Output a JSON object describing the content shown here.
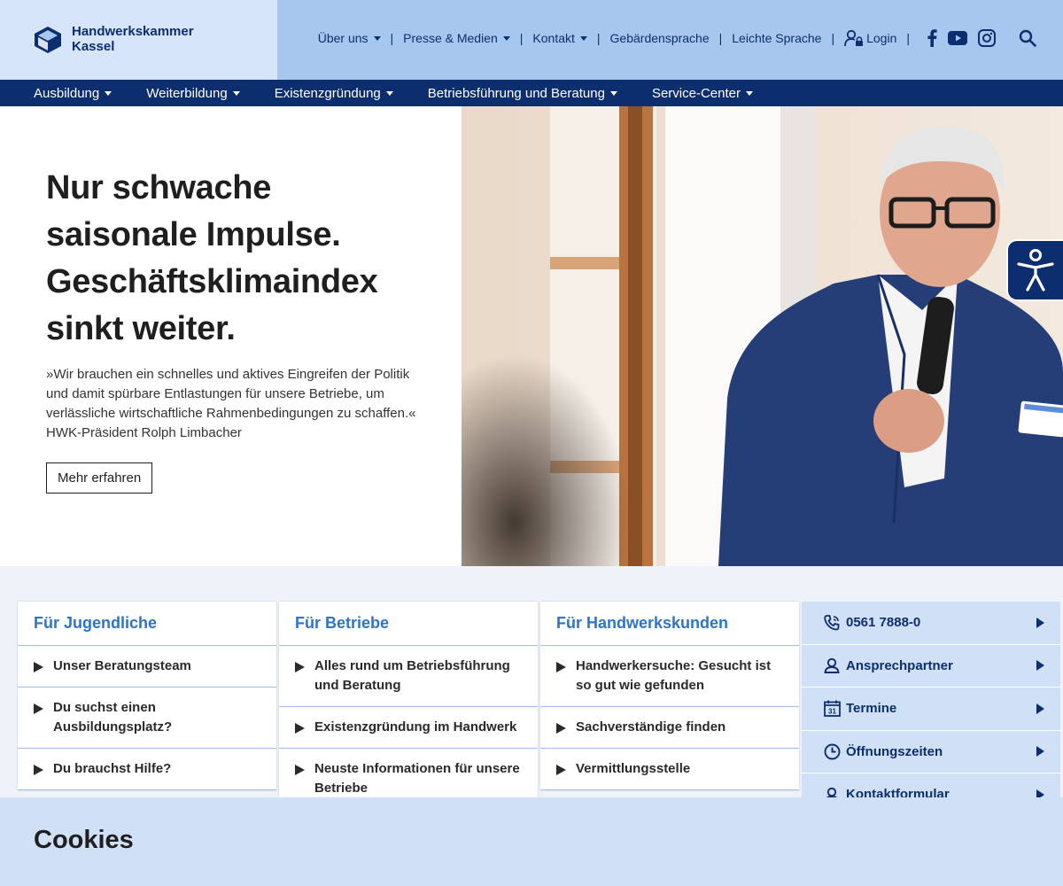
{
  "header": {
    "logo_line1": "Handwerkskammer",
    "logo_line2": "Kassel",
    "meta_nav": [
      {
        "label": "Über uns",
        "dropdown": true
      },
      {
        "label": "Presse & Medien",
        "dropdown": true
      },
      {
        "label": "Kontakt",
        "dropdown": true
      },
      {
        "label": "Gebärdensprache",
        "dropdown": false
      },
      {
        "label": "Leichte Sprache",
        "dropdown": false
      }
    ],
    "login_label": "Login",
    "separator": "|",
    "icons": [
      "user-lock-icon",
      "facebook-icon",
      "youtube-icon",
      "instagram-icon",
      "search-icon"
    ]
  },
  "main_nav": [
    {
      "label": "Ausbildung"
    },
    {
      "label": "Weiterbildung"
    },
    {
      "label": "Existenzgründung"
    },
    {
      "label": "Betriebsführung und Beratung"
    },
    {
      "label": "Service-Center"
    }
  ],
  "hero": {
    "title_lines": [
      "Nur schwache",
      "saisonale Impulse.",
      "Geschäftsklimaindex",
      "sinkt weiter."
    ],
    "quote": "»Wir brauchen ein schnelles und aktives Eingreifen der Politik und damit spürbare Entlastungen für unsere Betriebe, um verlässliche wirtschaftliche Rahmenbedingungen zu schaffen.« HWK-Präsident Rolph Limbacher",
    "button_label": "Mehr erfahren"
  },
  "columns": [
    {
      "title": "Für Jugendliche",
      "items": [
        "Unser Beratungsteam",
        "Du suchst einen Ausbildungsplatz?",
        "Du brauchst Hilfe?"
      ]
    },
    {
      "title": "Für Betriebe",
      "items": [
        "Alles rund um Betriebsführung und Beratung",
        "Existenzgründung im Handwerk",
        "Neuste Informationen für unsere Betriebe"
      ]
    },
    {
      "title": "Für Handwerkskunden",
      "items": [
        "Handwerkersuche: Gesucht ist so gut wie gefunden",
        "Sachverständige finden",
        "Vermittlungsstelle"
      ]
    }
  ],
  "service": [
    {
      "label": "0561 7888-0",
      "icon": "phone-icon"
    },
    {
      "label": "Ansprechpartner",
      "icon": "person-icon"
    },
    {
      "label": "Termine",
      "icon": "calendar-icon"
    },
    {
      "label": "Öffnungszeiten",
      "icon": "clock-icon"
    },
    {
      "label": "Kontaktformular",
      "icon": "contact-person-icon"
    }
  ],
  "calendar_day": "31",
  "cookies": {
    "title": "Cookies"
  },
  "colors": {
    "navy": "#0d2e6e",
    "header_blue": "#a7c7ef",
    "logo_bg": "#d6e5fa",
    "link_blue": "#2c74c9",
    "service_bg": "#cfe0f7"
  }
}
